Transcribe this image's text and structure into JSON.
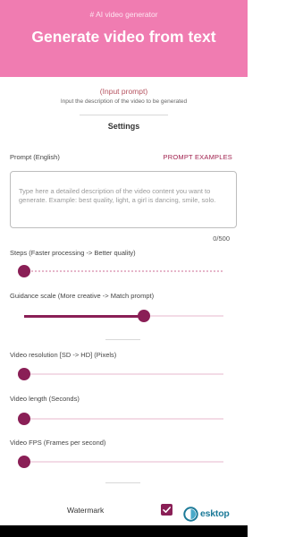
{
  "header": {
    "subtitle": "# AI video generator",
    "title": "Generate video from text"
  },
  "intro": {
    "required": "(Input prompt)",
    "description": "Input the description of the video to be generated"
  },
  "settings_title": "Settings",
  "prompt": {
    "label": "Prompt (English)",
    "examples_button": "PROMPT EXAMPLES",
    "value": "",
    "placeholder": "Type here a detailed description of the video content you want to generate. Example: best quality, light, a girl is dancing, smile, solo.",
    "counter": "0/500"
  },
  "sliders": [
    {
      "label": "Steps (Faster processing -> Better quality)",
      "value": 0.0
    },
    {
      "label": "Guidance scale (More creative -> Match prompt)",
      "value": 0.6
    },
    {
      "label": "Video resolution [SD -> HD] (Pixels)",
      "value": 0.0
    },
    {
      "label": "Video length (Seconds)",
      "value": 0.0
    },
    {
      "label": "Video FPS (Frames per second)",
      "value": 0.0
    }
  ],
  "watermark": {
    "label": "Watermark",
    "checked": true
  },
  "logo": {
    "text": "esktop"
  },
  "colors": {
    "header": "#f07cb1",
    "accent": "#8a1f56",
    "link": "#a1224f"
  }
}
